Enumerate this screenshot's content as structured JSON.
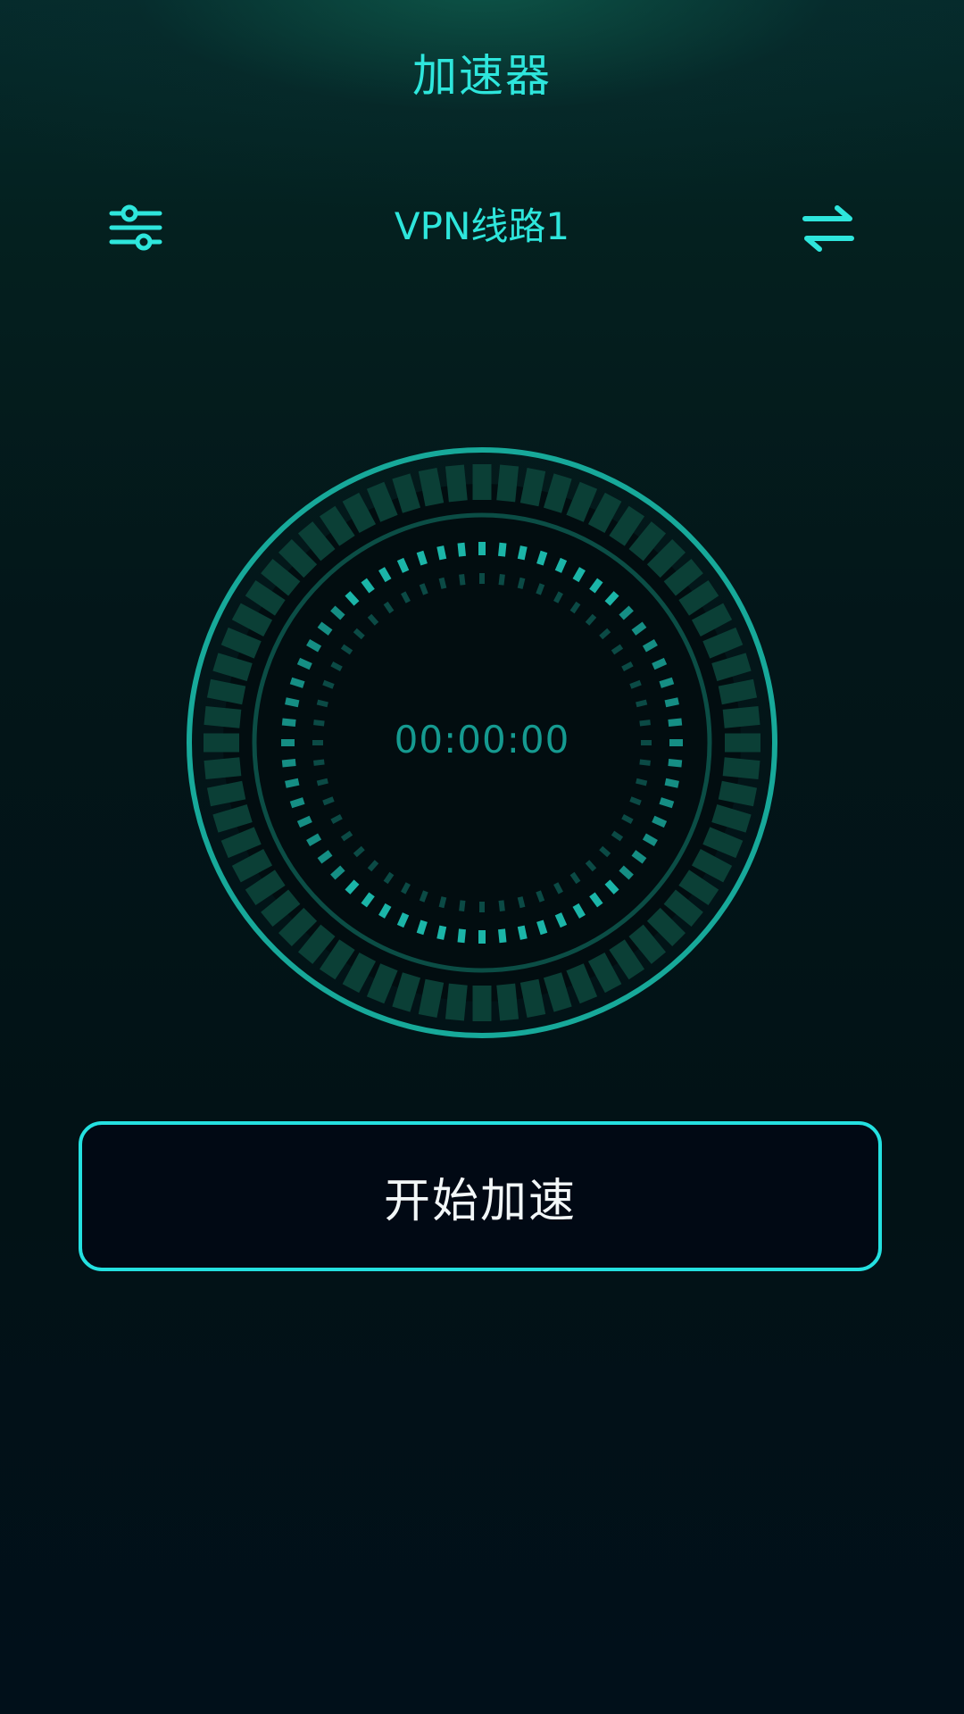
{
  "header": {
    "title": "加速器"
  },
  "toolbar": {
    "settings_icon": "sliders-icon",
    "line_label": "VPN线路1",
    "switch_icon": "swap-arrows-icon"
  },
  "gauge": {
    "timer": "00:00:00"
  },
  "action": {
    "start_label": "开始加速"
  },
  "colors": {
    "accent": "#2ee6dc",
    "button_border": "#24e0e0",
    "ring": "#17a99a",
    "timer": "#159a90",
    "background_top": "#052a2b",
    "background_bottom": "#01101a"
  }
}
